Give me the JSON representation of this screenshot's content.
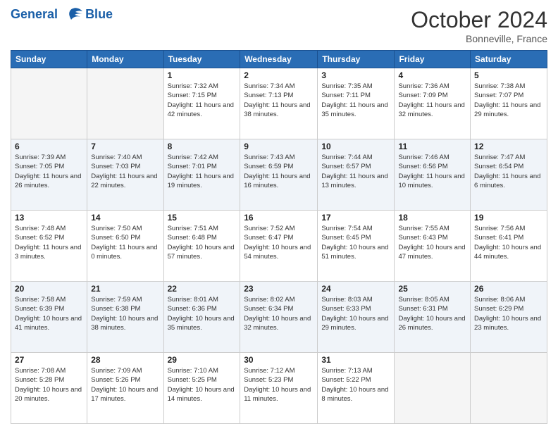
{
  "header": {
    "logo_line1": "General",
    "logo_line2": "Blue",
    "month": "October 2024",
    "location": "Bonneville, France"
  },
  "days_of_week": [
    "Sunday",
    "Monday",
    "Tuesday",
    "Wednesday",
    "Thursday",
    "Friday",
    "Saturday"
  ],
  "weeks": [
    [
      {
        "day": "",
        "info": ""
      },
      {
        "day": "",
        "info": ""
      },
      {
        "day": "1",
        "sunrise": "Sunrise: 7:32 AM",
        "sunset": "Sunset: 7:15 PM",
        "daylight": "Daylight: 11 hours and 42 minutes."
      },
      {
        "day": "2",
        "sunrise": "Sunrise: 7:34 AM",
        "sunset": "Sunset: 7:13 PM",
        "daylight": "Daylight: 11 hours and 38 minutes."
      },
      {
        "day": "3",
        "sunrise": "Sunrise: 7:35 AM",
        "sunset": "Sunset: 7:11 PM",
        "daylight": "Daylight: 11 hours and 35 minutes."
      },
      {
        "day": "4",
        "sunrise": "Sunrise: 7:36 AM",
        "sunset": "Sunset: 7:09 PM",
        "daylight": "Daylight: 11 hours and 32 minutes."
      },
      {
        "day": "5",
        "sunrise": "Sunrise: 7:38 AM",
        "sunset": "Sunset: 7:07 PM",
        "daylight": "Daylight: 11 hours and 29 minutes."
      }
    ],
    [
      {
        "day": "6",
        "sunrise": "Sunrise: 7:39 AM",
        "sunset": "Sunset: 7:05 PM",
        "daylight": "Daylight: 11 hours and 26 minutes."
      },
      {
        "day": "7",
        "sunrise": "Sunrise: 7:40 AM",
        "sunset": "Sunset: 7:03 PM",
        "daylight": "Daylight: 11 hours and 22 minutes."
      },
      {
        "day": "8",
        "sunrise": "Sunrise: 7:42 AM",
        "sunset": "Sunset: 7:01 PM",
        "daylight": "Daylight: 11 hours and 19 minutes."
      },
      {
        "day": "9",
        "sunrise": "Sunrise: 7:43 AM",
        "sunset": "Sunset: 6:59 PM",
        "daylight": "Daylight: 11 hours and 16 minutes."
      },
      {
        "day": "10",
        "sunrise": "Sunrise: 7:44 AM",
        "sunset": "Sunset: 6:57 PM",
        "daylight": "Daylight: 11 hours and 13 minutes."
      },
      {
        "day": "11",
        "sunrise": "Sunrise: 7:46 AM",
        "sunset": "Sunset: 6:56 PM",
        "daylight": "Daylight: 11 hours and 10 minutes."
      },
      {
        "day": "12",
        "sunrise": "Sunrise: 7:47 AM",
        "sunset": "Sunset: 6:54 PM",
        "daylight": "Daylight: 11 hours and 6 minutes."
      }
    ],
    [
      {
        "day": "13",
        "sunrise": "Sunrise: 7:48 AM",
        "sunset": "Sunset: 6:52 PM",
        "daylight": "Daylight: 11 hours and 3 minutes."
      },
      {
        "day": "14",
        "sunrise": "Sunrise: 7:50 AM",
        "sunset": "Sunset: 6:50 PM",
        "daylight": "Daylight: 11 hours and 0 minutes."
      },
      {
        "day": "15",
        "sunrise": "Sunrise: 7:51 AM",
        "sunset": "Sunset: 6:48 PM",
        "daylight": "Daylight: 10 hours and 57 minutes."
      },
      {
        "day": "16",
        "sunrise": "Sunrise: 7:52 AM",
        "sunset": "Sunset: 6:47 PM",
        "daylight": "Daylight: 10 hours and 54 minutes."
      },
      {
        "day": "17",
        "sunrise": "Sunrise: 7:54 AM",
        "sunset": "Sunset: 6:45 PM",
        "daylight": "Daylight: 10 hours and 51 minutes."
      },
      {
        "day": "18",
        "sunrise": "Sunrise: 7:55 AM",
        "sunset": "Sunset: 6:43 PM",
        "daylight": "Daylight: 10 hours and 47 minutes."
      },
      {
        "day": "19",
        "sunrise": "Sunrise: 7:56 AM",
        "sunset": "Sunset: 6:41 PM",
        "daylight": "Daylight: 10 hours and 44 minutes."
      }
    ],
    [
      {
        "day": "20",
        "sunrise": "Sunrise: 7:58 AM",
        "sunset": "Sunset: 6:39 PM",
        "daylight": "Daylight: 10 hours and 41 minutes."
      },
      {
        "day": "21",
        "sunrise": "Sunrise: 7:59 AM",
        "sunset": "Sunset: 6:38 PM",
        "daylight": "Daylight: 10 hours and 38 minutes."
      },
      {
        "day": "22",
        "sunrise": "Sunrise: 8:01 AM",
        "sunset": "Sunset: 6:36 PM",
        "daylight": "Daylight: 10 hours and 35 minutes."
      },
      {
        "day": "23",
        "sunrise": "Sunrise: 8:02 AM",
        "sunset": "Sunset: 6:34 PM",
        "daylight": "Daylight: 10 hours and 32 minutes."
      },
      {
        "day": "24",
        "sunrise": "Sunrise: 8:03 AM",
        "sunset": "Sunset: 6:33 PM",
        "daylight": "Daylight: 10 hours and 29 minutes."
      },
      {
        "day": "25",
        "sunrise": "Sunrise: 8:05 AM",
        "sunset": "Sunset: 6:31 PM",
        "daylight": "Daylight: 10 hours and 26 minutes."
      },
      {
        "day": "26",
        "sunrise": "Sunrise: 8:06 AM",
        "sunset": "Sunset: 6:29 PM",
        "daylight": "Daylight: 10 hours and 23 minutes."
      }
    ],
    [
      {
        "day": "27",
        "sunrise": "Sunrise: 7:08 AM",
        "sunset": "Sunset: 5:28 PM",
        "daylight": "Daylight: 10 hours and 20 minutes."
      },
      {
        "day": "28",
        "sunrise": "Sunrise: 7:09 AM",
        "sunset": "Sunset: 5:26 PM",
        "daylight": "Daylight: 10 hours and 17 minutes."
      },
      {
        "day": "29",
        "sunrise": "Sunrise: 7:10 AM",
        "sunset": "Sunset: 5:25 PM",
        "daylight": "Daylight: 10 hours and 14 minutes."
      },
      {
        "day": "30",
        "sunrise": "Sunrise: 7:12 AM",
        "sunset": "Sunset: 5:23 PM",
        "daylight": "Daylight: 10 hours and 11 minutes."
      },
      {
        "day": "31",
        "sunrise": "Sunrise: 7:13 AM",
        "sunset": "Sunset: 5:22 PM",
        "daylight": "Daylight: 10 hours and 8 minutes."
      },
      {
        "day": "",
        "info": ""
      },
      {
        "day": "",
        "info": ""
      }
    ]
  ]
}
